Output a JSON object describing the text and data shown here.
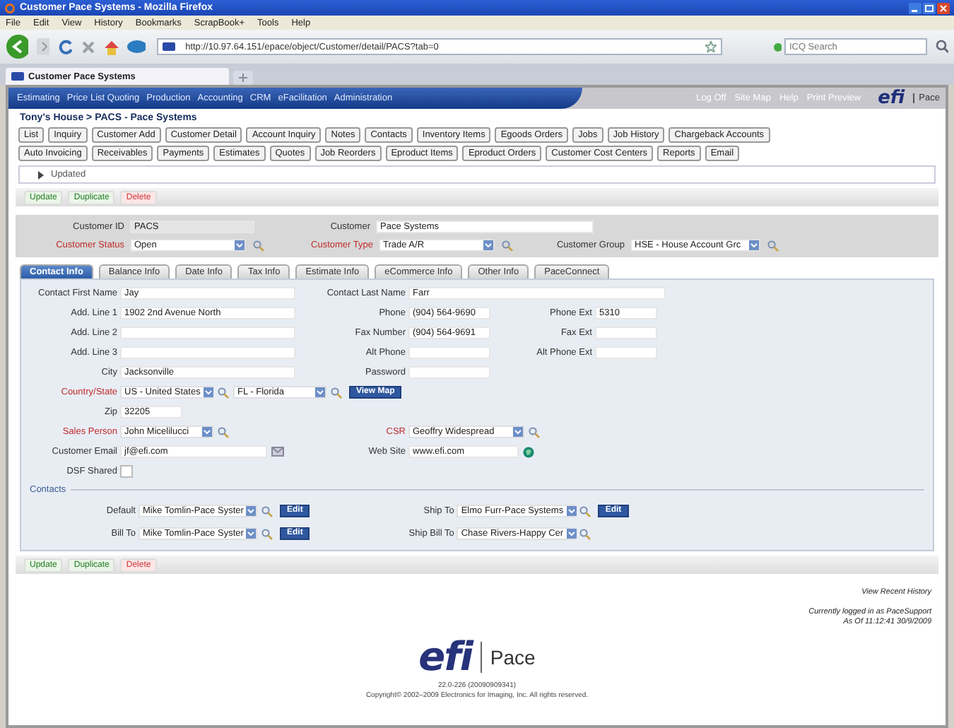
{
  "window": {
    "title": "Customer Pace Systems - Mozilla Firefox"
  },
  "menu": [
    "File",
    "Edit",
    "View",
    "History",
    "Bookmarks",
    "ScrapBook+",
    "Tools",
    "Help"
  ],
  "address_bar": {
    "value": "http://10.97.64.151/epace/object/Customer/detail/PACS?tab=0"
  },
  "search": {
    "placeholder": "ICQ Search"
  },
  "browser_tabs": [
    {
      "label": "Customer Pace Systems",
      "selected": true
    }
  ],
  "app_nav": {
    "items": [
      "Estimating",
      "Price List Quoting",
      "Production",
      "Accounting",
      "CRM",
      "eFacilitation",
      "Administration"
    ],
    "links": [
      "Log Off",
      "Site Map",
      "Help",
      "Print Preview"
    ],
    "logo": "efi",
    "product": "Pace"
  },
  "breadcrumb": "Tony's House > PACS - Pace Systems",
  "object_buttons": [
    [
      "List",
      "Inquiry",
      "Customer Add",
      "Customer Detail",
      "Account Inquiry",
      "Notes",
      "Contacts",
      "Inventory Items",
      "Egoods Orders",
      "Jobs",
      "Job History",
      "Chargeback Accounts"
    ],
    [
      "Auto Invoicing",
      "Receivables",
      "Payments",
      "Estimates",
      "Quotes",
      "Job Reorders",
      "Eproduct Items",
      "Eproduct Orders",
      "Customer Cost Centers",
      "Reports",
      "Email"
    ]
  ],
  "updated_section": {
    "label": "Updated",
    "expanded": false
  },
  "actions": [
    {
      "label": "Update",
      "kind": "ok"
    },
    {
      "label": "Duplicate",
      "kind": "ok"
    },
    {
      "label": "Delete",
      "kind": "danger"
    }
  ],
  "customer": {
    "id_label": "Customer ID",
    "id": "PACS",
    "name_label": "Customer",
    "name": "Pace Systems",
    "selects": [
      {
        "label": "Customer Status",
        "required": true,
        "value": "Open"
      },
      {
        "label": "Customer Type",
        "required": true,
        "value": "Trade A/R"
      },
      {
        "label": "Customer Group",
        "required": false,
        "value": "HSE - House Account Grc"
      }
    ]
  },
  "detail_tabs": [
    {
      "label": "Contact Info",
      "selected": true
    },
    {
      "label": "Balance Info",
      "selected": false
    },
    {
      "label": "Date Info",
      "selected": false
    },
    {
      "label": "Tax Info",
      "selected": false
    },
    {
      "label": "Estimate Info",
      "selected": false
    },
    {
      "label": "eCommerce Info",
      "selected": false
    },
    {
      "label": "Other Info",
      "selected": false
    },
    {
      "label": "PaceConnect",
      "selected": false
    }
  ],
  "form_rows": [
    {
      "cells": [
        {
          "label": "Contact First Name",
          "controls": [
            {
              "kind": "text",
              "value": "Jay"
            }
          ]
        },
        {
          "label": "Contact Last Name",
          "controls": [
            {
              "kind": "text",
              "value": "Farr"
            }
          ]
        }
      ]
    },
    {
      "cells": [
        {
          "label": "Add. Line 1",
          "controls": [
            {
              "kind": "text",
              "value": "1902 2nd Avenue North"
            }
          ]
        },
        {
          "label": "Phone",
          "controls": [
            {
              "kind": "text",
              "value": "(904) 564-9690"
            }
          ]
        },
        {
          "label": "Phone Ext",
          "controls": [
            {
              "kind": "text",
              "value": "5310"
            }
          ]
        }
      ]
    },
    {
      "cells": [
        {
          "label": "Add. Line 2",
          "controls": [
            {
              "kind": "text"
            }
          ]
        },
        {
          "label": "Fax Number",
          "controls": [
            {
              "kind": "text",
              "value": "(904) 564-9691"
            }
          ]
        },
        {
          "label": "Fax Ext",
          "controls": [
            {
              "kind": "text"
            }
          ]
        }
      ]
    },
    {
      "cells": [
        {
          "label": "Add. Line 3",
          "controls": [
            {
              "kind": "text"
            }
          ]
        },
        {
          "label": "Alt Phone",
          "controls": [
            {
              "kind": "text"
            }
          ]
        },
        {
          "label": "Alt Phone Ext",
          "controls": [
            {
              "kind": "text"
            }
          ]
        }
      ]
    },
    {
      "cells": [
        {
          "label": "City",
          "controls": [
            {
              "kind": "text",
              "value": "Jacksonville"
            }
          ]
        },
        {
          "label": "Password",
          "controls": [
            {
              "kind": "text"
            }
          ]
        }
      ]
    },
    {
      "cells": [
        {
          "label": "Country/State",
          "required": true,
          "controls": [
            {
              "kind": "select",
              "value": "US - United States"
            },
            {
              "kind": "search"
            },
            {
              "kind": "select",
              "value": "FL - Florida"
            },
            {
              "kind": "search"
            },
            {
              "kind": "button",
              "value": "View Map"
            }
          ]
        }
      ]
    },
    {
      "cells": [
        {
          "label": "Zip",
          "controls": [
            {
              "kind": "text",
              "value": "32205"
            }
          ]
        }
      ]
    },
    {
      "cells": [
        {
          "label": "Sales Person",
          "required": true,
          "controls": [
            {
              "kind": "select",
              "value": "John Micelilucci"
            },
            {
              "kind": "search"
            }
          ]
        },
        {
          "label": "CSR",
          "required": true,
          "controls": [
            {
              "kind": "select",
              "value": "Geoffry Widespread"
            },
            {
              "kind": "search"
            }
          ]
        }
      ]
    },
    {
      "cells": [
        {
          "label": "Customer Email",
          "controls": [
            {
              "kind": "text",
              "value": "jf@efi.com"
            },
            {
              "kind": "mail"
            }
          ]
        },
        {
          "label": "Web Site",
          "controls": [
            {
              "kind": "text",
              "value": "www.efi.com"
            },
            {
              "kind": "globe"
            }
          ]
        }
      ]
    },
    {
      "cells": [
        {
          "label": "DSF Shared",
          "controls": [
            {
              "kind": "check",
              "checked": false
            }
          ]
        }
      ]
    }
  ],
  "contacts": {
    "title": "Contacts",
    "rows": [
      {
        "cells": [
          {
            "label": "Default",
            "controls": [
              {
                "kind": "select",
                "value": "Mike Tomlin-Pace Syster"
              },
              {
                "kind": "search"
              },
              {
                "kind": "button",
                "value": "Edit"
              }
            ]
          },
          {
            "label": "Ship To",
            "controls": [
              {
                "kind": "select",
                "value": "Elmo Furr-Pace Systems"
              },
              {
                "kind": "search"
              },
              {
                "kind": "button",
                "value": "Edit"
              }
            ]
          }
        ]
      },
      {
        "cells": [
          {
            "label": "Bill To",
            "controls": [
              {
                "kind": "select",
                "value": "Mike Tomlin-Pace Syster"
              },
              {
                "kind": "search"
              },
              {
                "kind": "button",
                "value": "Edit"
              }
            ]
          },
          {
            "label": "Ship Bill To",
            "controls": [
              {
                "kind": "select",
                "value": "Chase Rivers-Happy Cer"
              },
              {
                "kind": "search"
              }
            ]
          }
        ]
      }
    ]
  },
  "bottom_actions": [
    {
      "label": "Update",
      "kind": "ok"
    },
    {
      "label": "Duplicate",
      "kind": "ok"
    },
    {
      "label": "Delete",
      "kind": "danger"
    }
  ],
  "footer": {
    "history_link": "View Recent History",
    "login": "Currently logged in as PaceSupport",
    "as_of": "As Of 11:12:41 30/9/2009",
    "logo": "efi",
    "product": "Pace",
    "version": "22.0-226 (20090909341)",
    "copyright": "Copyright© 2002–2009 Electronics for Imaging, Inc. All rights reserved."
  }
}
